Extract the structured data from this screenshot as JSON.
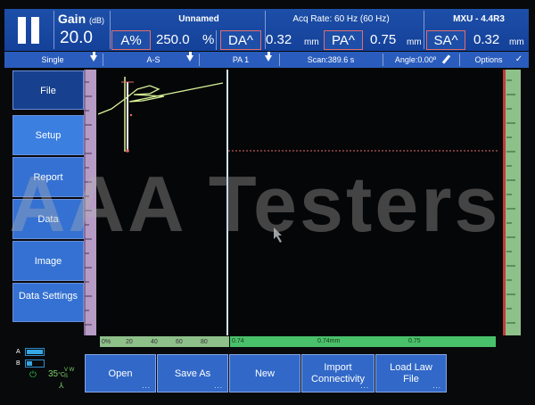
{
  "top": {
    "gain_label": "Gain",
    "gain_unit": "(dB)",
    "gain_value": "20.0",
    "title": "Unnamed",
    "acq_rate": "Acq Rate: 60 Hz (60 Hz)",
    "model": "MXU - 4.4R3",
    "readouts": [
      {
        "label": "A%",
        "value": "250.0",
        "unit": "%"
      },
      {
        "label": "DA^",
        "value": "0.32",
        "unit": "mm"
      },
      {
        "label": "PA^",
        "value": "0.75",
        "unit": "mm"
      },
      {
        "label": "SA^",
        "value": "0.32",
        "unit": "mm"
      }
    ]
  },
  "toolbar": {
    "single": "Single",
    "view": "A-S",
    "pa": "PA 1",
    "scan": "Scan:389.6 s",
    "angle": "Angle:0.00º",
    "options": "Options"
  },
  "menu": [
    {
      "label": "File"
    },
    {
      "label": "Setup"
    },
    {
      "label": "Report"
    },
    {
      "label": "Data"
    },
    {
      "label": "Image"
    },
    {
      "label": "Data Settings"
    }
  ],
  "ruler_bottom_left": [
    "0%",
    "20",
    "40",
    "60",
    "80"
  ],
  "ruler_bottom_right": {
    "left": "0.74",
    "mid": "0.74mm",
    "right": "0.75"
  },
  "buttons": [
    {
      "label": "Open",
      "dots": "..."
    },
    {
      "label": "Save As",
      "dots": "..."
    },
    {
      "label": "New",
      "dots": ""
    },
    {
      "label": "Import Connectivity",
      "dots": "..."
    },
    {
      "label": "Load Law File",
      "dots": "..."
    }
  ],
  "status": {
    "battery_a": "A",
    "battery_b": "B",
    "temp": "35",
    "temp_unit": "°C",
    "vw": "V W",
    "s": "S"
  },
  "watermark": "AAA Testers",
  "colors": {
    "header_blue": "#1d4fa8",
    "button_blue": "#3269c8",
    "ruler_green": "#49c06a",
    "ruler_purple": "#b69bc4",
    "gate_red": "#e56b6b",
    "signal_green": "#d8f29a"
  }
}
